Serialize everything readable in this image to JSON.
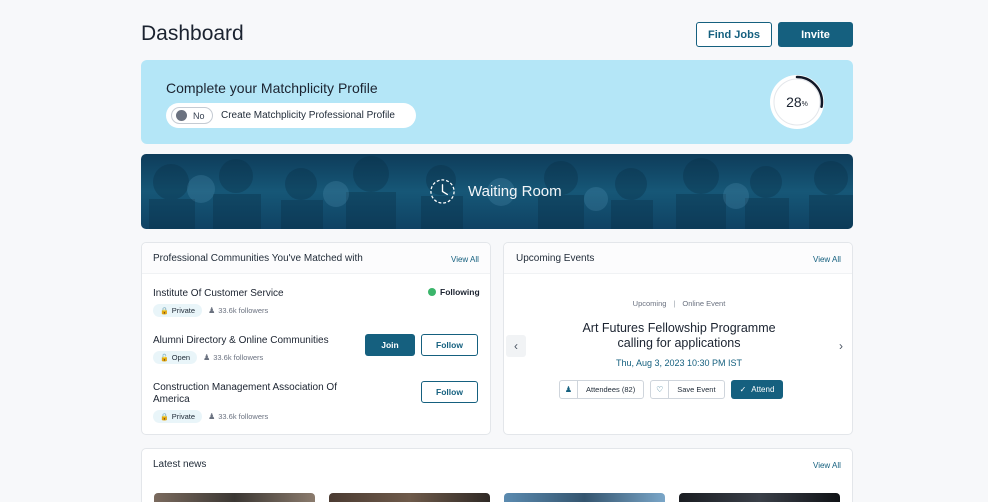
{
  "header": {
    "title": "Dashboard",
    "find_jobs_label": "Find Jobs",
    "invite_label": "Invite"
  },
  "profile": {
    "title": "Complete your Matchplicity Profile",
    "toggle_state": "No",
    "toggle_label": "Create Matchplicity Professional Profile",
    "progress_value": "28",
    "progress_unit": "%",
    "progress_fraction": 0.28
  },
  "waiting_room": {
    "label": "Waiting Room"
  },
  "communities": {
    "title": "Professional Communities You've Matched with",
    "view_all": "View All",
    "items": [
      {
        "name": "Institute Of Customer Service",
        "privacy": "Private",
        "followers": "33.6k followers",
        "status": "Following"
      },
      {
        "name": "Alumni Directory & Online Communities",
        "privacy": "Open",
        "followers": "33.6k followers",
        "join_label": "Join",
        "follow_label": "Follow"
      },
      {
        "name": "Construction Management Association Of America",
        "privacy": "Private",
        "followers": "33.6k followers",
        "follow_label": "Follow"
      }
    ]
  },
  "events": {
    "title": "Upcoming Events",
    "view_all": "View All",
    "event": {
      "type": "Upcoming",
      "mode": "Online Event",
      "name": "Art Futures Fellowship Programme calling for applications",
      "date": "Thu, Aug 3, 2023 10:30 PM IST",
      "attendees_label": "Attendees (82)",
      "save_label": "Save Event",
      "attend_label": "Attend"
    }
  },
  "news": {
    "title": "Latest news",
    "view_all": "View All"
  },
  "colors": {
    "primary": "#15607f",
    "profile_bg": "#b4e6f7",
    "following_green": "#3bb56b"
  }
}
